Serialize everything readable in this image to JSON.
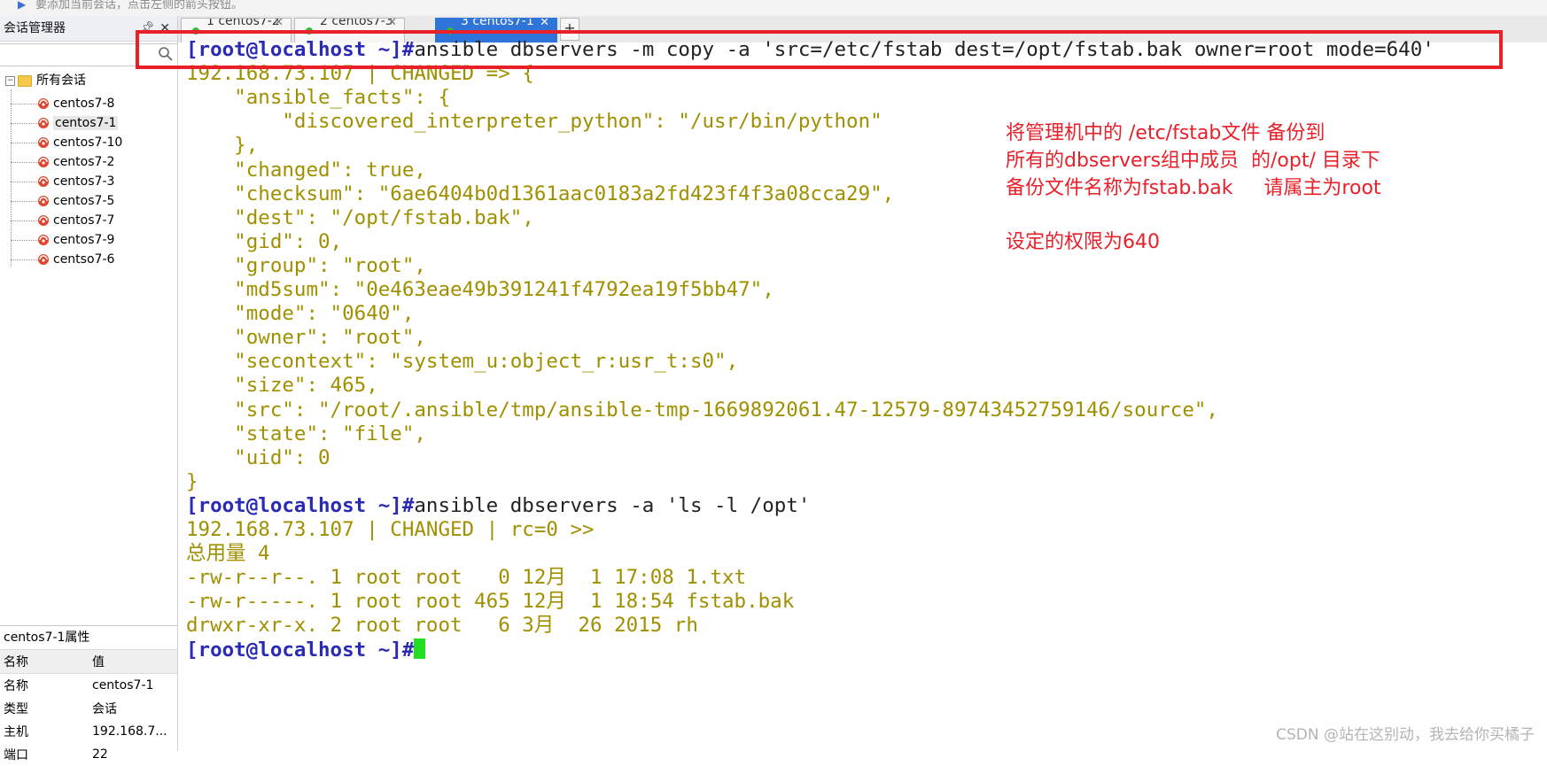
{
  "top_hint": "要添加当前会话，点击左侧的箭头按钮。",
  "session_manager": {
    "title": "会话管理器",
    "root_label": "所有会话",
    "sessions": [
      "centos7-8",
      "centos7-1",
      "centos7-10",
      "centos7-2",
      "centos7-3",
      "centos7-5",
      "centos7-7",
      "centos7-9",
      "centso7-6"
    ],
    "selected": "centos7-1"
  },
  "properties": {
    "title": "centos7-1属性",
    "col_name": "名称",
    "col_value": "值",
    "rows": [
      {
        "name": "名称",
        "value": "centos7-1"
      },
      {
        "name": "类型",
        "value": "会话"
      },
      {
        "name": "主机",
        "value": "192.168.7..."
      },
      {
        "name": "端口",
        "value": "22"
      }
    ]
  },
  "tabs": [
    {
      "label": "1 centos7-2",
      "active": false
    },
    {
      "label": "2 centos7-3",
      "active": false
    },
    {
      "label": "3 centos7-1",
      "active": true
    }
  ],
  "add_tab": "+",
  "terminal": {
    "prompt": "[root@localhost ~]#",
    "cmd1": "ansible dbservers -m copy -a 'src=/etc/fstab dest=/opt/fstab.bak owner=root mode=640'",
    "out1": [
      "192.168.73.107 | CHANGED => {",
      "    \"ansible_facts\": {",
      "        \"discovered_interpreter_python\": \"/usr/bin/python\"",
      "    },",
      "    \"changed\": true,",
      "    \"checksum\": \"6ae6404b0d1361aac0183a2fd423f4f3a08cca29\",",
      "    \"dest\": \"/opt/fstab.bak\",",
      "    \"gid\": 0,",
      "    \"group\": \"root\",",
      "    \"md5sum\": \"0e463eae49b391241f4792ea19f5bb47\",",
      "    \"mode\": \"0640\",",
      "    \"owner\": \"root\",",
      "    \"secontext\": \"system_u:object_r:usr_t:s0\",",
      "    \"size\": 465,",
      "    \"src\": \"/root/.ansible/tmp/ansible-tmp-1669892061.47-12579-89743452759146/source\",",
      "    \"state\": \"file\",",
      "    \"uid\": 0",
      "}"
    ],
    "cmd2": "ansible dbservers -a 'ls -l /opt'",
    "out2": [
      "192.168.73.107 | CHANGED | rc=0 >>",
      "总用量 4",
      "-rw-r--r--. 1 root root   0 12月  1 17:08 1.txt",
      "-rw-r-----. 1 root root 465 12月  1 18:54 fstab.bak",
      "drwxr-xr-x. 2 root root   6 3月  26 2015 rh"
    ]
  },
  "annotations": [
    "将管理机中的 /etc/fstab文件 备份到",
    "所有的dbservers组中成员  的/opt/ 目录下",
    "备份文件名称为fstab.bak     请属主为root",
    "设定的权限为640"
  ],
  "watermark": "CSDN @站在这别动，我去给你买橘子",
  "colors": {
    "prompt": "#2a2ab5",
    "output": "#a09000",
    "annotation": "#e8202a",
    "active_tab": "#2f74d8",
    "cursor": "#22dd22"
  }
}
